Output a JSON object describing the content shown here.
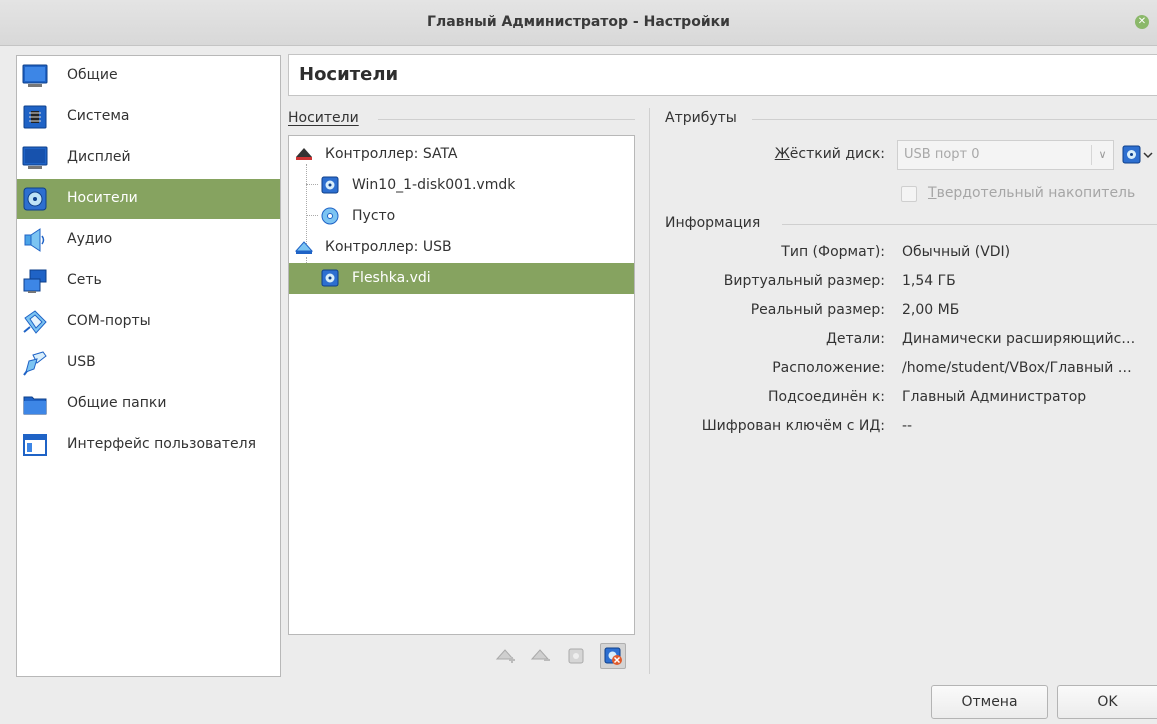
{
  "window": {
    "title": "Главный Администратор - Настройки",
    "close_icon": "close-icon",
    "accent_color": "#86a360"
  },
  "sidebar": {
    "items": [
      {
        "label": "Общие",
        "icon": "general-icon",
        "active": false
      },
      {
        "label": "Система",
        "icon": "system-icon",
        "active": false
      },
      {
        "label": "Дисплей",
        "icon": "display-icon",
        "active": false
      },
      {
        "label": "Носители",
        "icon": "storage-icon",
        "active": true
      },
      {
        "label": "Аудио",
        "icon": "audio-icon",
        "active": false
      },
      {
        "label": "Сеть",
        "icon": "network-icon",
        "active": false
      },
      {
        "label": "COM-порты",
        "icon": "serial-ports-icon",
        "active": false
      },
      {
        "label": "USB",
        "icon": "usb-icon",
        "active": false
      },
      {
        "label": "Общие папки",
        "icon": "shared-folders-icon",
        "active": false
      },
      {
        "label": "Интерфейс пользователя",
        "icon": "user-interface-icon",
        "active": false
      }
    ]
  },
  "page": {
    "title": "Носители"
  },
  "storage": {
    "group_title": "Носители",
    "tree": [
      {
        "label": "Контроллер: SATA",
        "type": "controller",
        "icon": "sata-controller-icon",
        "selected": false
      },
      {
        "label": "Win10_1-disk001.vmdk",
        "type": "hard-disk",
        "icon": "hard-disk-icon",
        "selected": false
      },
      {
        "label": "Пусто",
        "type": "optical",
        "icon": "optical-disc-icon",
        "selected": false
      },
      {
        "label": "Контроллер: USB",
        "type": "controller",
        "icon": "usb-controller-icon",
        "selected": false
      },
      {
        "label": "Fleshka.vdi",
        "type": "hard-disk",
        "icon": "hard-disk-icon",
        "selected": true
      }
    ],
    "toolbar": [
      "add-controller-icon",
      "remove-controller-icon",
      "add-attachment-icon",
      "remove-attachment-icon"
    ]
  },
  "attributes": {
    "group_title": "Атрибуты",
    "hard_disk_label": "Жёсткий диск:",
    "hard_disk_value": "USB порт 0",
    "ssd_label": "Твердотельный накопитель",
    "ssd_checked": false
  },
  "information": {
    "group_title": "Информация",
    "rows": [
      {
        "label": "Тип (Формат):",
        "value": "Обычный (VDI)"
      },
      {
        "label": "Виртуальный размер:",
        "value": "1,54 ГБ"
      },
      {
        "label": "Реальный размер:",
        "value": "2,00 МБ"
      },
      {
        "label": "Детали:",
        "value": "Динамически расширяющийс…"
      },
      {
        "label": "Расположение:",
        "value": "/home/student/VBox/Главный …"
      },
      {
        "label": "Подсоединён к:",
        "value": "Главный Администратор"
      },
      {
        "label": "Шифрован ключём с ИД:",
        "value": "--"
      }
    ]
  },
  "buttons": {
    "cancel": "Отмена",
    "ok": "OK"
  }
}
